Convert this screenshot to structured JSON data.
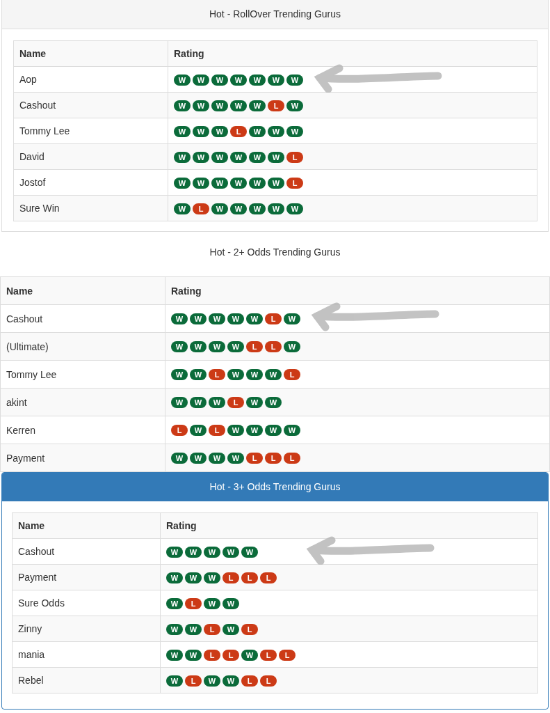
{
  "panels": [
    {
      "kind": "bordered",
      "title": "Hot - RollOver Trending Gurus",
      "columns": [
        "Name",
        "Rating"
      ],
      "rows": [
        {
          "name": "Aop",
          "arrow": true,
          "results": [
            {
              "label": "W",
              "kind": "win"
            },
            {
              "label": "W",
              "kind": "win"
            },
            {
              "label": "W",
              "kind": "win"
            },
            {
              "label": "W",
              "kind": "win"
            },
            {
              "label": "W",
              "kind": "win"
            },
            {
              "label": "W",
              "kind": "win"
            },
            {
              "label": "W",
              "kind": "win"
            }
          ]
        },
        {
          "name": "Cashout",
          "arrow": false,
          "results": [
            {
              "label": "W",
              "kind": "win"
            },
            {
              "label": "W",
              "kind": "win"
            },
            {
              "label": "W",
              "kind": "win"
            },
            {
              "label": "W",
              "kind": "win"
            },
            {
              "label": "W",
              "kind": "win"
            },
            {
              "label": "L",
              "kind": "loss"
            },
            {
              "label": "W",
              "kind": "win"
            }
          ]
        },
        {
          "name": "Tommy Lee",
          "arrow": false,
          "results": [
            {
              "label": "W",
              "kind": "win"
            },
            {
              "label": "W",
              "kind": "win"
            },
            {
              "label": "W",
              "kind": "win"
            },
            {
              "label": "L",
              "kind": "loss"
            },
            {
              "label": "W",
              "kind": "win"
            },
            {
              "label": "W",
              "kind": "win"
            },
            {
              "label": "W",
              "kind": "win"
            }
          ]
        },
        {
          "name": "David",
          "arrow": false,
          "results": [
            {
              "label": "W",
              "kind": "win"
            },
            {
              "label": "W",
              "kind": "win"
            },
            {
              "label": "W",
              "kind": "win"
            },
            {
              "label": "W",
              "kind": "win"
            },
            {
              "label": "W",
              "kind": "win"
            },
            {
              "label": "W",
              "kind": "win"
            },
            {
              "label": "L",
              "kind": "loss"
            }
          ]
        },
        {
          "name": "Jostof",
          "arrow": false,
          "results": [
            {
              "label": "W",
              "kind": "win"
            },
            {
              "label": "W",
              "kind": "win"
            },
            {
              "label": "W",
              "kind": "win"
            },
            {
              "label": "W",
              "kind": "win"
            },
            {
              "label": "W",
              "kind": "win"
            },
            {
              "label": "W",
              "kind": "win"
            },
            {
              "label": "L",
              "kind": "loss"
            }
          ]
        },
        {
          "name": "Sure Win",
          "arrow": false,
          "results": [
            {
              "label": "W",
              "kind": "win"
            },
            {
              "label": "L",
              "kind": "loss"
            },
            {
              "label": "W",
              "kind": "win"
            },
            {
              "label": "W",
              "kind": "win"
            },
            {
              "label": "W",
              "kind": "win"
            },
            {
              "label": "W",
              "kind": "win"
            },
            {
              "label": "W",
              "kind": "win"
            }
          ]
        }
      ]
    },
    {
      "kind": "plain",
      "title": "Hot - 2+ Odds Trending Gurus",
      "columns": [
        "Name",
        "Rating"
      ],
      "rows": [
        {
          "name": "Cashout",
          "arrow": true,
          "results": [
            {
              "label": "W",
              "kind": "win"
            },
            {
              "label": "W",
              "kind": "win"
            },
            {
              "label": "W",
              "kind": "win"
            },
            {
              "label": "W",
              "kind": "win"
            },
            {
              "label": "W",
              "kind": "win"
            },
            {
              "label": "L",
              "kind": "loss"
            },
            {
              "label": "W",
              "kind": "win"
            }
          ]
        },
        {
          "name": "(Ultimate)",
          "arrow": false,
          "results": [
            {
              "label": "W",
              "kind": "win"
            },
            {
              "label": "W",
              "kind": "win"
            },
            {
              "label": "W",
              "kind": "win"
            },
            {
              "label": "W",
              "kind": "win"
            },
            {
              "label": "L",
              "kind": "loss"
            },
            {
              "label": "L",
              "kind": "loss"
            },
            {
              "label": "W",
              "kind": "win"
            }
          ]
        },
        {
          "name": "Tommy Lee",
          "arrow": false,
          "results": [
            {
              "label": "W",
              "kind": "win"
            },
            {
              "label": "W",
              "kind": "win"
            },
            {
              "label": "L",
              "kind": "loss"
            },
            {
              "label": "W",
              "kind": "win"
            },
            {
              "label": "W",
              "kind": "win"
            },
            {
              "label": "W",
              "kind": "win"
            },
            {
              "label": "L",
              "kind": "loss"
            }
          ]
        },
        {
          "name": "akint",
          "arrow": false,
          "results": [
            {
              "label": "W",
              "kind": "win"
            },
            {
              "label": "W",
              "kind": "win"
            },
            {
              "label": "W",
              "kind": "win"
            },
            {
              "label": "L",
              "kind": "loss"
            },
            {
              "label": "W",
              "kind": "win"
            },
            {
              "label": "W",
              "kind": "win"
            }
          ]
        },
        {
          "name": "Kerren",
          "arrow": false,
          "results": [
            {
              "label": "L",
              "kind": "loss"
            },
            {
              "label": "W",
              "kind": "win"
            },
            {
              "label": "L",
              "kind": "loss"
            },
            {
              "label": "W",
              "kind": "win"
            },
            {
              "label": "W",
              "kind": "win"
            },
            {
              "label": "W",
              "kind": "win"
            },
            {
              "label": "W",
              "kind": "win"
            }
          ]
        },
        {
          "name": "Payment",
          "arrow": false,
          "results": [
            {
              "label": "W",
              "kind": "win"
            },
            {
              "label": "W",
              "kind": "win"
            },
            {
              "label": "W",
              "kind": "win"
            },
            {
              "label": "W",
              "kind": "win"
            },
            {
              "label": "L",
              "kind": "loss"
            },
            {
              "label": "L",
              "kind": "loss"
            },
            {
              "label": "L",
              "kind": "loss"
            }
          ]
        }
      ]
    },
    {
      "kind": "primary",
      "title": "Hot - 3+ Odds Trending Gurus",
      "columns": [
        "Name",
        "Rating"
      ],
      "rows": [
        {
          "name": "Cashout",
          "arrow": true,
          "results": [
            {
              "label": "W",
              "kind": "win"
            },
            {
              "label": "W",
              "kind": "win"
            },
            {
              "label": "W",
              "kind": "win"
            },
            {
              "label": "W",
              "kind": "win"
            },
            {
              "label": "W",
              "kind": "win"
            }
          ]
        },
        {
          "name": "Payment",
          "arrow": false,
          "results": [
            {
              "label": "W",
              "kind": "win"
            },
            {
              "label": "W",
              "kind": "win"
            },
            {
              "label": "W",
              "kind": "win"
            },
            {
              "label": "L",
              "kind": "loss"
            },
            {
              "label": "L",
              "kind": "loss"
            },
            {
              "label": "L",
              "kind": "loss"
            }
          ]
        },
        {
          "name": "Sure Odds",
          "arrow": false,
          "results": [
            {
              "label": "W",
              "kind": "win"
            },
            {
              "label": "L",
              "kind": "loss"
            },
            {
              "label": "W",
              "kind": "win"
            },
            {
              "label": "W",
              "kind": "win"
            }
          ]
        },
        {
          "name": "Zinny",
          "arrow": false,
          "results": [
            {
              "label": "W",
              "kind": "win"
            },
            {
              "label": "W",
              "kind": "win"
            },
            {
              "label": "L",
              "kind": "loss"
            },
            {
              "label": "W",
              "kind": "win"
            },
            {
              "label": "L",
              "kind": "loss"
            }
          ]
        },
        {
          "name": "mania",
          "arrow": false,
          "results": [
            {
              "label": "W",
              "kind": "win"
            },
            {
              "label": "W",
              "kind": "win"
            },
            {
              "label": "L",
              "kind": "loss"
            },
            {
              "label": "L",
              "kind": "loss"
            },
            {
              "label": "W",
              "kind": "win"
            },
            {
              "label": "L",
              "kind": "loss"
            },
            {
              "label": "L",
              "kind": "loss"
            }
          ]
        },
        {
          "name": "Rebel",
          "arrow": false,
          "results": [
            {
              "label": "W",
              "kind": "win"
            },
            {
              "label": "L",
              "kind": "loss"
            },
            {
              "label": "W",
              "kind": "win"
            },
            {
              "label": "W",
              "kind": "win"
            },
            {
              "label": "L",
              "kind": "loss"
            },
            {
              "label": "L",
              "kind": "loss"
            }
          ]
        }
      ]
    }
  ]
}
